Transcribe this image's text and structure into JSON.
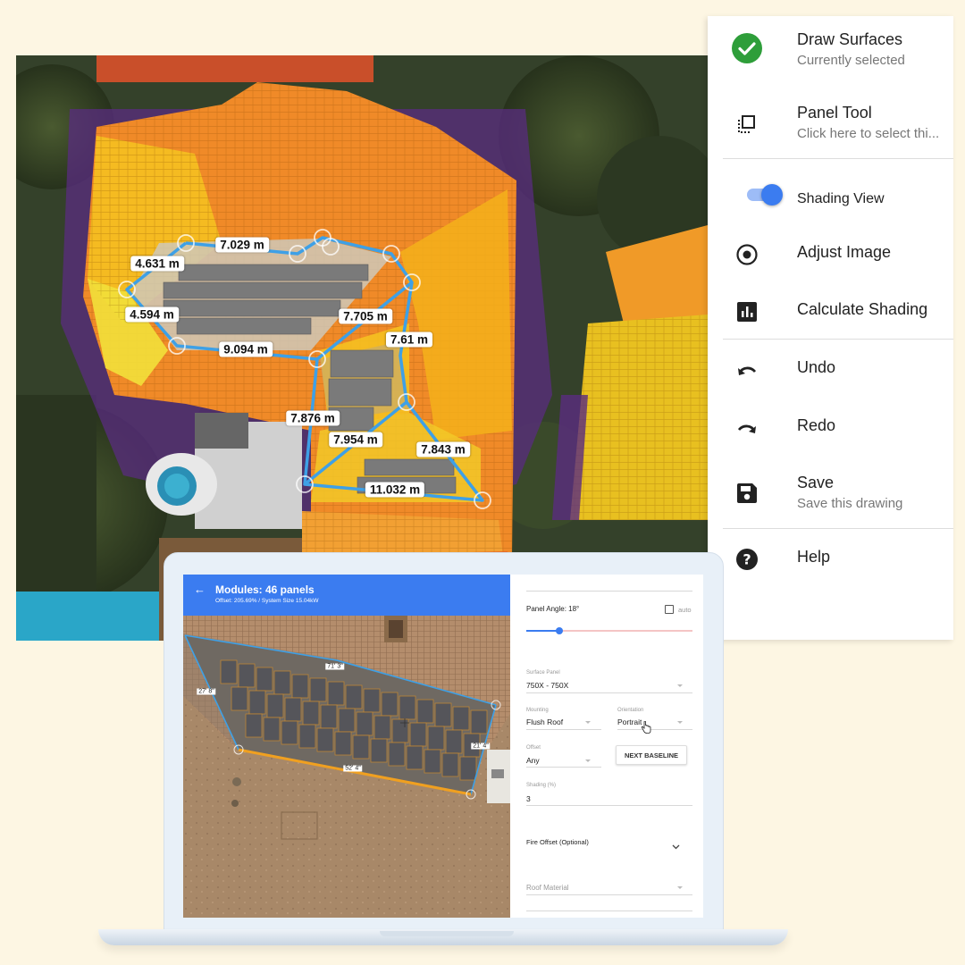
{
  "map": {
    "measurements": [
      "7.029 m",
      "4.631 m",
      "4.594 m",
      "9.094 m",
      "7.705 m",
      "7.61 m",
      "7.876 m",
      "7.954 m",
      "7.843 m",
      "11.032 m"
    ]
  },
  "menu": {
    "draw_surfaces": {
      "title": "Draw Surfaces",
      "subtitle": "Currently selected",
      "icon": "check-circle-icon"
    },
    "panel_tool": {
      "title": "Panel Tool",
      "subtitle": "Click here to select thi...",
      "icon": "panel-select-icon"
    },
    "shading_view": {
      "title": "Shading View",
      "toggle_on": true
    },
    "adjust_image": {
      "title": "Adjust Image",
      "icon": "radio-target-icon"
    },
    "calculate_shading": {
      "title": "Calculate Shading",
      "icon": "bar-chart-icon"
    },
    "undo": {
      "title": "Undo",
      "icon": "undo-icon"
    },
    "redo": {
      "title": "Redo",
      "icon": "redo-icon"
    },
    "save": {
      "title": "Save",
      "subtitle": "Save this drawing",
      "icon": "save-icon"
    },
    "help": {
      "title": "Help",
      "icon": "help-icon"
    }
  },
  "laptop": {
    "header": {
      "back": "←",
      "title": "Modules: 46 panels",
      "subtitle": "Offset: 205.69% / System Size 15.04kW"
    },
    "dimensions": [
      "71' 3\"",
      "27' 8\"",
      "21' 4\"",
      "52' 4\""
    ],
    "panel": {
      "panel_angle": "Panel Angle: 18°",
      "auto_label": "auto",
      "panel_angle_fraction": 0.2,
      "surface_panel_label": "Surface Panel",
      "surface_panel_value": "750X - 750X",
      "mounting_label": "Mounting",
      "mounting_value": "Flush Roof",
      "orientation_label": "Orientation",
      "orientation_value": "Portrait",
      "offset_label": "Offset",
      "offset_value": "Any",
      "next_baseline": "NEXT BASELINE",
      "shading_label": "Shading (%)",
      "shading_value": "3",
      "fire_offset": "Fire Offset (Optional)",
      "roof_material": "Roof Material"
    },
    "colors": {
      "accent": "#3b7cf0",
      "roof_outline": "#3ea0e6",
      "edge_highlight": "#f0a020"
    }
  }
}
